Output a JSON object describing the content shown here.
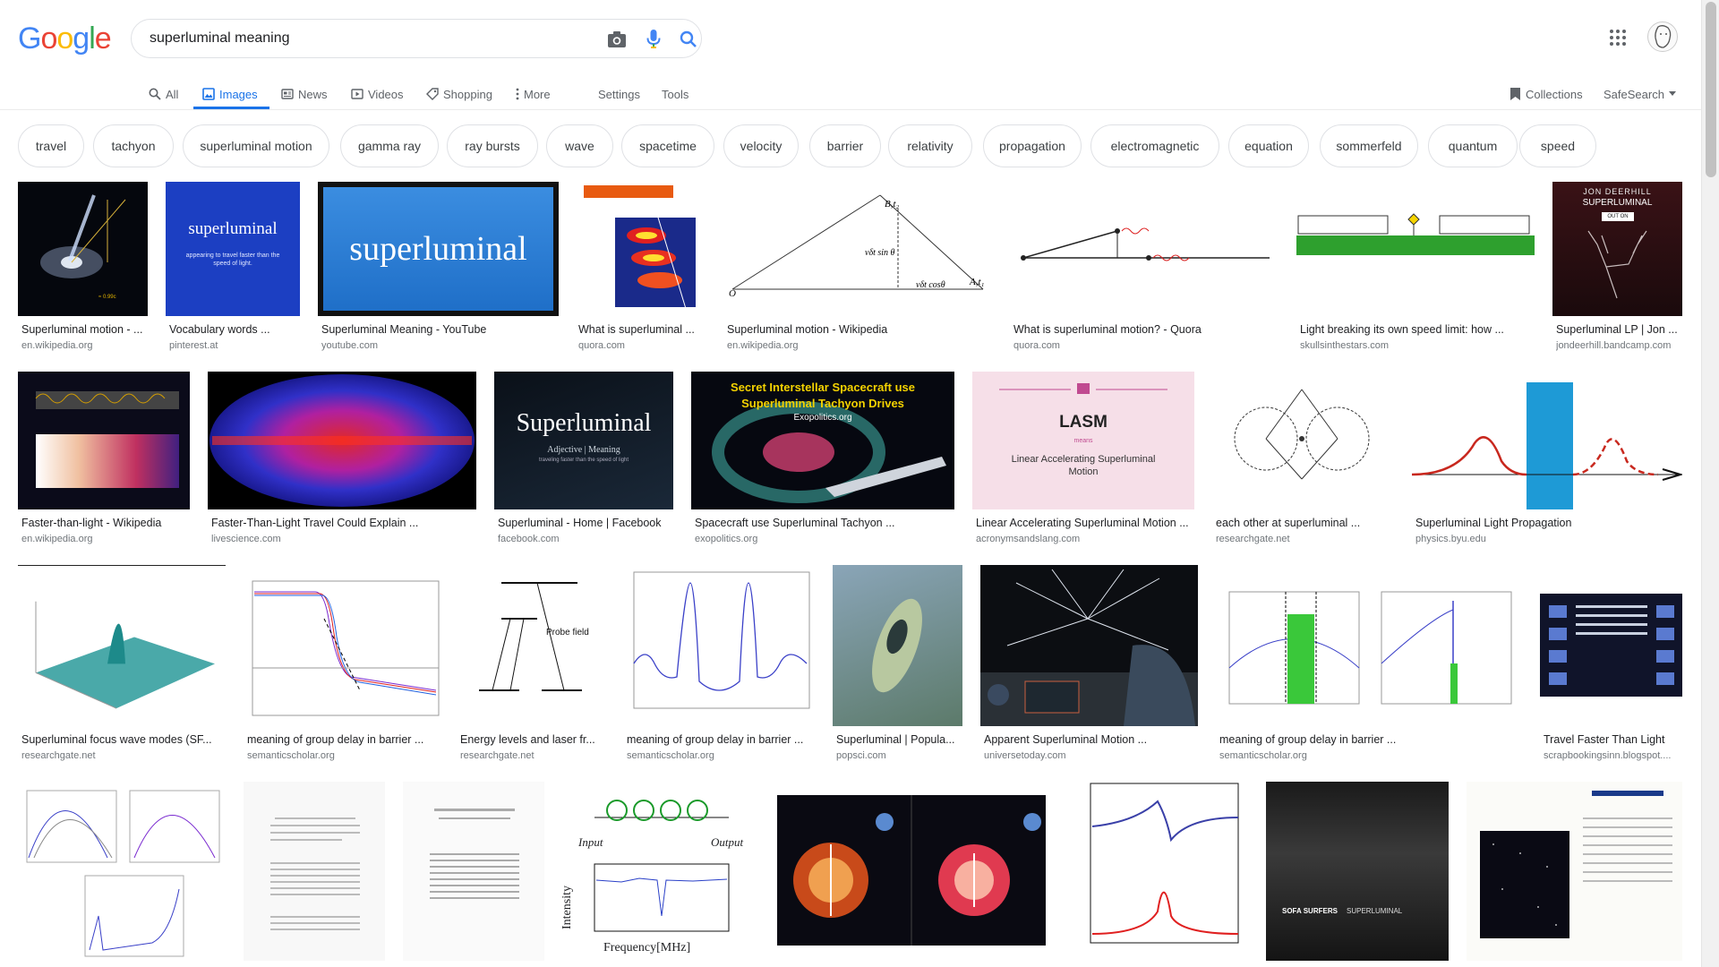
{
  "logo": {
    "letters": [
      "G",
      "o",
      "o",
      "g",
      "l",
      "e"
    ],
    "colors": [
      "#4285F4",
      "#EA4335",
      "#FBBC05",
      "#4285F4",
      "#34A853",
      "#EA4335"
    ]
  },
  "search": {
    "query": "superluminal meaning"
  },
  "icons": {
    "camera": "camera-icon",
    "mic": "mic-icon",
    "search": "search-icon",
    "apps": "apps-grid-icon"
  },
  "tabs": {
    "all": "All",
    "images": "Images",
    "news": "News",
    "videos": "Videos",
    "shopping": "Shopping",
    "more": "More",
    "settings": "Settings",
    "tools": "Tools",
    "collections": "Collections",
    "safesearch": "SafeSearch"
  },
  "chips": [
    "travel",
    "tachyon",
    "superluminal motion",
    "gamma ray",
    "ray bursts",
    "wave",
    "spacetime",
    "velocity",
    "barrier",
    "relativity",
    "propagation",
    "electromagnetic",
    "equation",
    "sommerfeld",
    "quantum",
    "speed"
  ],
  "results": [
    {
      "title": "Superluminal motion - ...",
      "domain": "en.wikipedia.org"
    },
    {
      "title": "Vocabulary words ...",
      "domain": "pinterest.at"
    },
    {
      "title": "Superluminal Meaning - YouTube",
      "domain": "youtube.com"
    },
    {
      "title": "What is superluminal ...",
      "domain": "quora.com"
    },
    {
      "title": "Superluminal motion - Wikipedia",
      "domain": "en.wikipedia.org"
    },
    {
      "title": "What is superluminal motion? - Quora",
      "domain": "quora.com"
    },
    {
      "title": "Light breaking its own speed limit: how ...",
      "domain": "skullsinthestars.com"
    },
    {
      "title": "Superluminal LP | Jon ...",
      "domain": "jondeerhill.bandcamp.com"
    },
    {
      "title": "Faster-than-light - Wikipedia",
      "domain": "en.wikipedia.org"
    },
    {
      "title": "Faster-Than-Light Travel Could Explain ...",
      "domain": "livescience.com"
    },
    {
      "title": "Superluminal - Home | Facebook",
      "domain": "facebook.com"
    },
    {
      "title": "Spacecraft use Superluminal Tachyon ...",
      "domain": "exopolitics.org"
    },
    {
      "title": "Linear Accelerating Superluminal Motion ...",
      "domain": "acronymsandslang.com"
    },
    {
      "title": "each other at superluminal ...",
      "domain": "researchgate.net"
    },
    {
      "title": "Superluminal Light Propagation",
      "domain": "physics.byu.edu"
    },
    {
      "title": "Superluminal focus wave modes (SF...",
      "domain": "researchgate.net"
    },
    {
      "title": "meaning of group delay in barrier ...",
      "domain": "semanticscholar.org"
    },
    {
      "title": "Energy levels and laser fr...",
      "domain": "researchgate.net"
    },
    {
      "title": "meaning of group delay in barrier ...",
      "domain": "semanticscholar.org"
    },
    {
      "title": "Superluminal | Popula...",
      "domain": "popsci.com"
    },
    {
      "title": "Apparent Superluminal Motion ...",
      "domain": "universetoday.com"
    },
    {
      "title": "meaning of group delay in barrier ...",
      "domain": "semanticscholar.org"
    },
    {
      "title": "Travel Faster Than Light",
      "domain": "scrapbookingsinn.blogspot...."
    }
  ],
  "thumb_text": {
    "superluminal_card": "superluminal",
    "superluminal_card_sub": "appearing to travel faster than the speed of light.",
    "youtube_word": "superluminal",
    "fb_word": "Superluminal",
    "fb_sub": "Adjective | Meaning",
    "fb_sub2": "traveling faster than the speed of light",
    "exo_title": "Secret Interstellar Spacecraft use",
    "exo_title2": "Superluminal Tachyon Drives",
    "exo_site": "Exopolitics.org",
    "lasm": "LASM",
    "lasm_means": "means",
    "lasm_full": "Linear Accelerating Superluminal",
    "lasm_full2": "Motion",
    "bandcamp_name": "JON DEERHILL",
    "bandcamp_title": "SUPERLUMINAL",
    "bandcamp_out": "OUT ON",
    "sofa": "SOFA SURFERS",
    "sofa2": "SUPERLUMINAL",
    "probe_field": "Probe field",
    "input": "Input",
    "output": "Output",
    "intensity": "Intensity",
    "frequency": "Frequency[MHz]"
  },
  "colors": {
    "accent": "#1a73e8",
    "chip_border": "#dfe1e5",
    "domain_text": "#70757a"
  }
}
